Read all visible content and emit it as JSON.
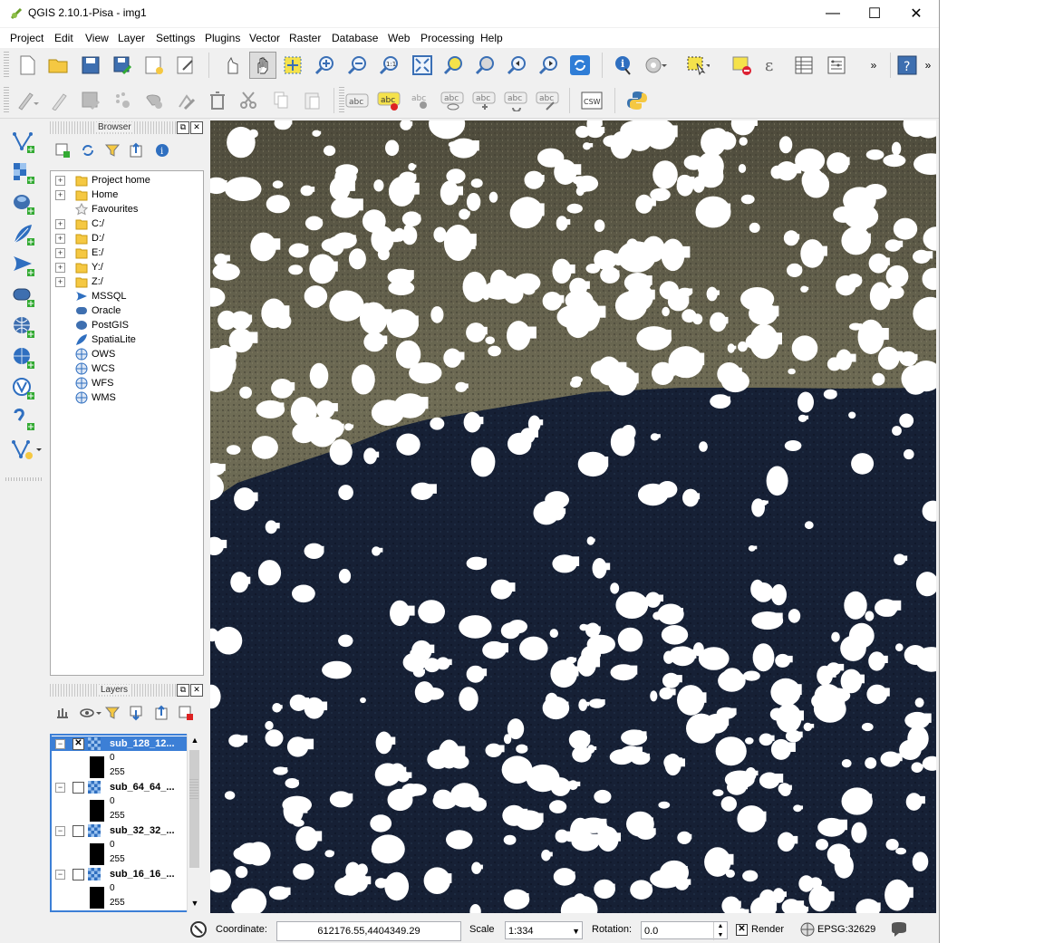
{
  "window": {
    "title": "QGIS 2.10.1-Pisa - img1"
  },
  "controls": {
    "minimize": "—",
    "maximize": "☐",
    "close": "✕"
  },
  "menu": [
    "Project",
    "Edit",
    "View",
    "Layer",
    "Settings",
    "Plugins",
    "Vector",
    "Raster",
    "Database",
    "Web",
    "Processing",
    "Help"
  ],
  "toolbar": {
    "overflow": "»",
    "label_tools": [
      "abc",
      "abc",
      "abc",
      "abc",
      "abc",
      "abc",
      "abc"
    ],
    "csw": "CSW"
  },
  "browser": {
    "title": "Browser",
    "items": [
      {
        "label": "Project home",
        "icon": "folder-icon",
        "expandable": true
      },
      {
        "label": "Home",
        "icon": "folder-icon",
        "expandable": true
      },
      {
        "label": "Favourites",
        "icon": "star-icon",
        "expandable": false
      },
      {
        "label": "C:/",
        "icon": "folder-icon",
        "expandable": true
      },
      {
        "label": "D:/",
        "icon": "folder-icon",
        "expandable": true
      },
      {
        "label": "E:/",
        "icon": "folder-icon",
        "expandable": true
      },
      {
        "label": "Y:/",
        "icon": "folder-icon",
        "expandable": true
      },
      {
        "label": "Z:/",
        "icon": "folder-icon",
        "expandable": true
      },
      {
        "label": "MSSQL",
        "icon": "mssql-icon",
        "expandable": false
      },
      {
        "label": "Oracle",
        "icon": "oracle-icon",
        "expandable": false
      },
      {
        "label": "PostGIS",
        "icon": "postgis-icon",
        "expandable": false
      },
      {
        "label": "SpatiaLite",
        "icon": "spatialite-icon",
        "expandable": false
      },
      {
        "label": "OWS",
        "icon": "ows-icon",
        "expandable": false
      },
      {
        "label": "WCS",
        "icon": "wcs-icon",
        "expandable": false
      },
      {
        "label": "WFS",
        "icon": "wfs-icon",
        "expandable": false
      },
      {
        "label": "WMS",
        "icon": "wms-icon",
        "expandable": false
      }
    ]
  },
  "layers": {
    "title": "Layers",
    "items": [
      {
        "name": "sub_128_12...",
        "checked": true,
        "selected": true,
        "min": "0",
        "max": "255"
      },
      {
        "name": "sub_64_64_...",
        "checked": false,
        "selected": false,
        "min": "0",
        "max": "255"
      },
      {
        "name": "sub_32_32_...",
        "checked": false,
        "selected": false,
        "min": "0",
        "max": "255"
      },
      {
        "name": "sub_16_16_...",
        "checked": false,
        "selected": false,
        "min": "0",
        "max": "255"
      }
    ]
  },
  "status": {
    "coordinate_label": "Coordinate:",
    "coordinate_value": "612176.55,4404349.29",
    "scale_label": "Scale",
    "scale_value": "1:334",
    "rotation_label": "Rotation:",
    "rotation_value": "0.0",
    "render_label": "Render",
    "render_checked": true,
    "crs": "EPSG:32629"
  },
  "colors": {
    "accent": "#3c7fd6",
    "folder": "#f5c842",
    "forest_light": "#6f6c55",
    "forest_dark": "#162035",
    "mask": "#ffffff"
  }
}
